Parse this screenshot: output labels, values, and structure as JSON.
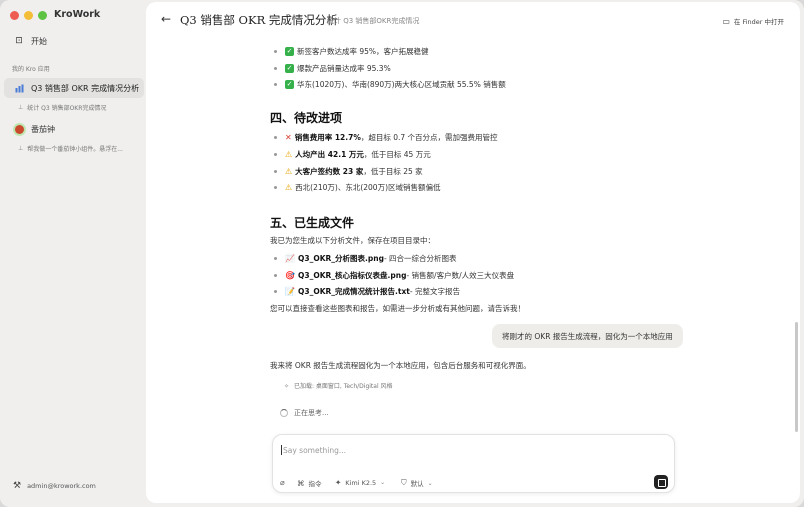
{
  "brand": "KroWork",
  "sidebar": {
    "start_label": "开始",
    "section_label": "我的 Kro 应用",
    "apps": [
      {
        "label": "Q3 销售部 OKR 完成情况分析",
        "sub": "统计 Q3 销售部OKR完成情况"
      },
      {
        "label": "番茄钟",
        "sub": "帮我做一个番茄钟小组件。悬浮在..."
      }
    ],
    "user_email": "admin@krowork.com"
  },
  "header": {
    "title": "Q3 销售部 OKR 完成情况分析",
    "subtitle": "统计 Q3 销售部OKR完成情况",
    "finder_label": "在 Finder 中打开"
  },
  "content": {
    "top_items": [
      "新签客户数达成率 95%，客户拓展稳健",
      "爆款产品销量达成率 95.3%",
      "华东(1020万)、华南(890万)两大核心区域贡献 55.5% 销售额"
    ],
    "section4_title": "四、待改进项",
    "improve_items": [
      {
        "bold": "销售费用率 12.7%",
        "rest": "，超目标 0.7 个百分点，需加强费用管控"
      },
      {
        "bold": "人均产出 42.1 万元",
        "rest": "，低于目标 45 万元"
      },
      {
        "bold": "大客户签约数 23 家",
        "rest": "，低于目标 25 家"
      },
      {
        "bold": "",
        "rest": "西北(210万)、东北(200万)区域销售额偏低"
      }
    ],
    "section5_title": "五、已生成文件",
    "files_intro": "我已为您生成以下分析文件，保存在项目目录中：",
    "files": [
      {
        "emoji": "📈",
        "name": "Q3_OKR_分析图表.png",
        "desc": " - 四合一综合分析图表"
      },
      {
        "emoji": "🎯",
        "name": "Q3_OKR_核心指标仪表盘.png",
        "desc": " - 销售额/客户数/人效三大仪表盘"
      },
      {
        "emoji": "📝",
        "name": "Q3_OKR_完成情况统计报告.txt",
        "desc": " - 完整文字报告"
      }
    ],
    "closing": "您可以直接查看这些图表和报告，如需进一步分析或有其他问题，请告诉我！",
    "user_message": "将刚才的 OKR 报告生成流程，固化为一个本地应用",
    "assistant_reply": "我来将 OKR 报告生成流程固化为一个本地应用，包含后台服务和可视化界面。",
    "added_note": "已加载: 桌面窗口, Tech/Digital 风格",
    "thinking": "正在思考..."
  },
  "composer": {
    "placeholder": "Say something...",
    "commands_label": "指令",
    "model_label": "Kimi K2.5",
    "mode_label": "默认"
  }
}
